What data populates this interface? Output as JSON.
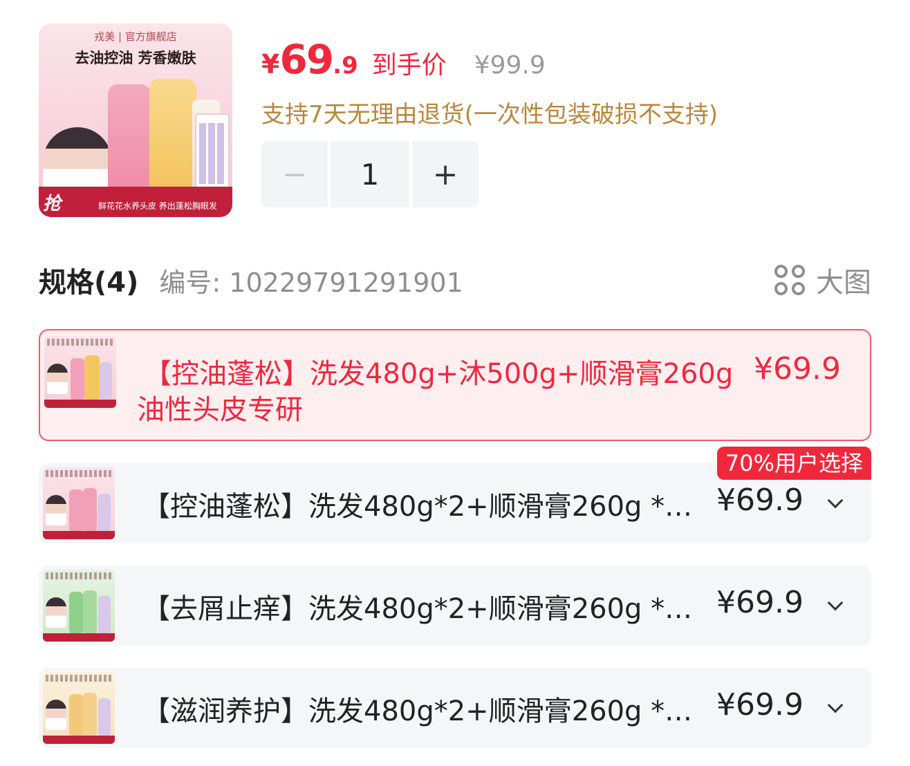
{
  "product": {
    "thumbnail": {
      "store_text": "戎美 | 官方旗舰店",
      "slogan": "去油控油 芳香嫩肤",
      "grab_text": "抢",
      "band_text": "鲜花花水养头皮 养出蓬松胸眼发"
    },
    "price": {
      "currency": "¥",
      "integer": "69",
      "decimal": ".9",
      "tag": "到手价",
      "original": "¥99.9"
    },
    "return_policy": "支持7天无理由退货(一次性包装破损不支持)",
    "stepper": {
      "minus": "−",
      "quantity": "1",
      "plus": "+"
    }
  },
  "spec": {
    "title": "规格(4)",
    "code_label": "编号: 10229791291901",
    "big_image_label": "大图"
  },
  "variants": [
    {
      "name_line1": "【控油蓬松】洗发480g+沐500g+顺滑膏260g",
      "name_line2": "油性头皮专研",
      "price": "¥69.9",
      "selected": true,
      "theme": "pink"
    },
    {
      "name_line1": "【控油蓬松】洗发480g*2+顺滑膏260g *…",
      "price": "¥69.9",
      "badge": "70%用户选择",
      "theme": "pink"
    },
    {
      "name_line1": "【去屑止痒】洗发480g*2+顺滑膏260g *…",
      "price": "¥69.9",
      "theme": "green"
    },
    {
      "name_line1": "【滋润养护】洗发480g*2+顺滑膏260g *…",
      "price": "¥69.9",
      "theme": "yellow"
    }
  ],
  "colors": {
    "accent": "#f0283c",
    "gold": "#b9863d",
    "muted": "#8e8e8e",
    "row_bg": "#f5f6f8",
    "selected_bg": "#fdeef0"
  },
  "icons": [
    "grid-icon",
    "chevron-down-icon"
  ]
}
